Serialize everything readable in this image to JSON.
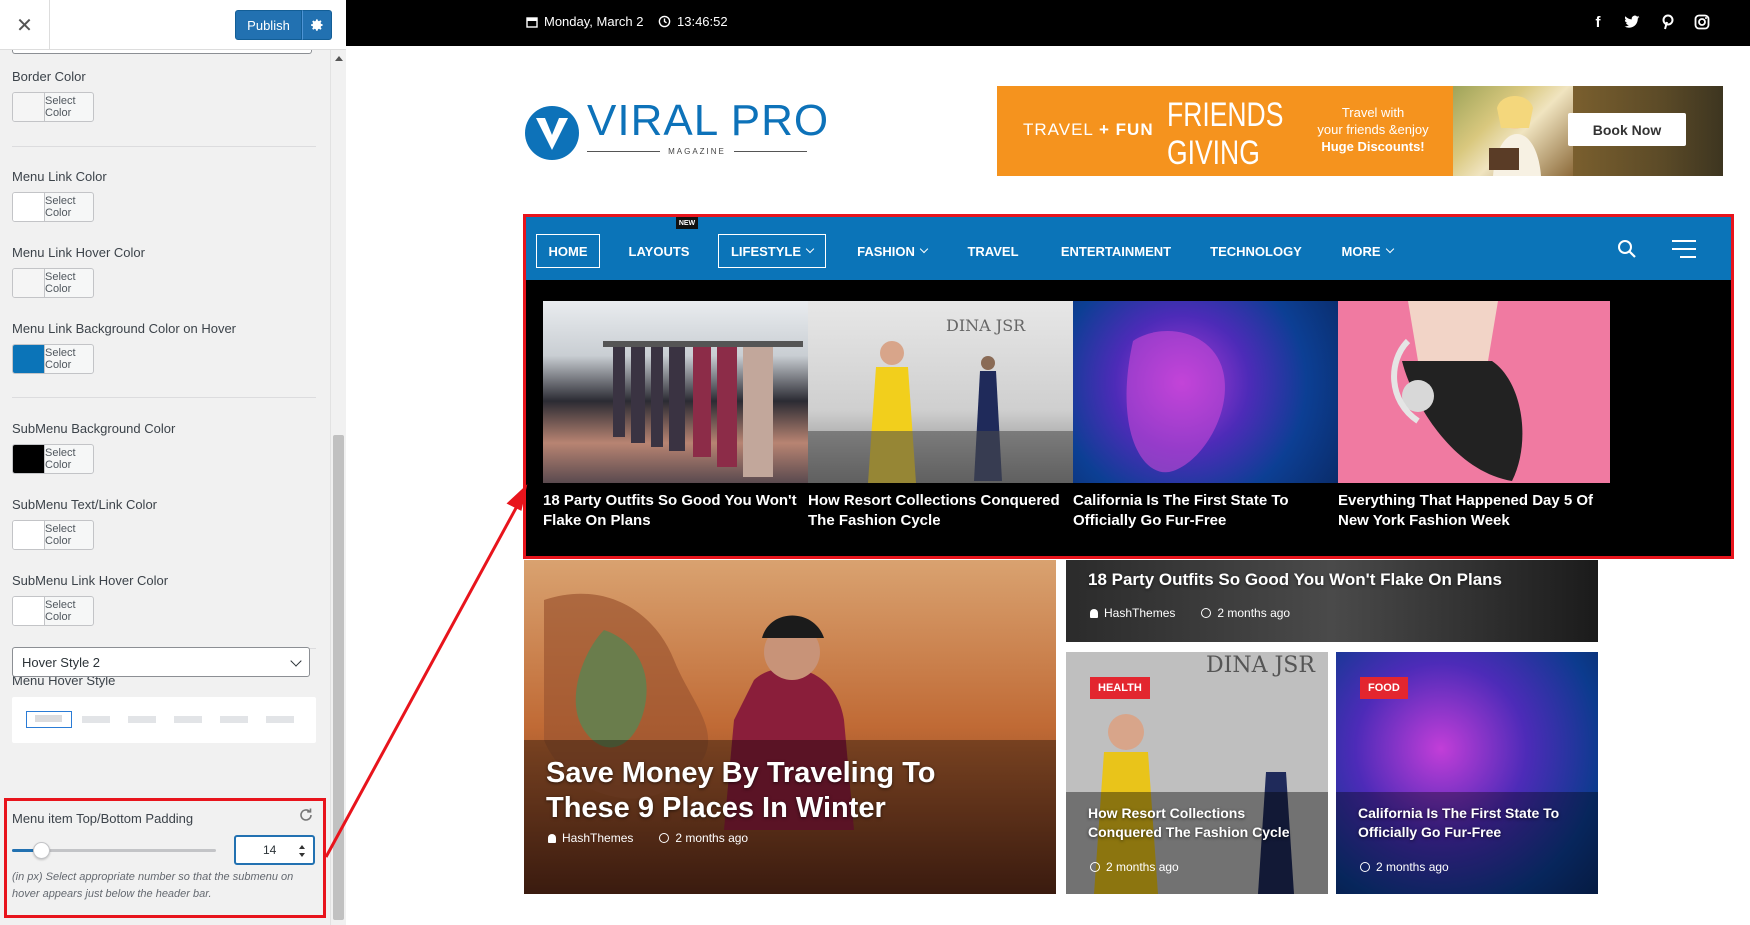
{
  "customizer": {
    "close_symbol": "✕",
    "publish_label": "Publish",
    "controls": {
      "border_color": {
        "label": "Border Color",
        "swatch": "#f5f5f5",
        "button": "Select Color"
      },
      "menu_link_color": {
        "label": "Menu Link Color",
        "swatch": "#ffffff",
        "button": "Select Color"
      },
      "menu_link_hover_color": {
        "label": "Menu Link Hover Color",
        "swatch": "#f5f5f5",
        "button": "Select Color"
      },
      "menu_link_bg_hover": {
        "label": "Menu Link Background Color on Hover",
        "swatch": "#0b74b8",
        "button": "Select Color"
      },
      "submenu_bg_color": {
        "label": "SubMenu Background Color",
        "swatch": "#000000",
        "button": "Select Color"
      },
      "submenu_text_color": {
        "label": "SubMenu Text/Link Color",
        "swatch": "#ffffff",
        "button": "Select Color"
      },
      "submenu_link_hover": {
        "label": "SubMenu Link Hover Color",
        "swatch": "#ffffff",
        "button": "Select Color"
      }
    },
    "menu_hover_style": {
      "label": "Menu Hover Style",
      "selected": "Hover Style 2"
    },
    "padding": {
      "label": "Menu item Top/Bottom Padding",
      "value": "14",
      "slider_fraction": 0.14,
      "help": "(in px) Select appropriate number so that the submenu on hover appears just below the header bar."
    },
    "accent_color": "#2271b1",
    "highlight_color": "#e8141c"
  },
  "site": {
    "topbar": {
      "date": "Monday, March 2",
      "time": "13:46:52"
    },
    "social_icons": [
      "facebook-icon",
      "twitter-icon",
      "pinterest-icon",
      "instagram-icon"
    ],
    "logo": {
      "word": "VIRAL PRO",
      "sub": "MAGAZINE"
    },
    "ad": {
      "travel": "TRAVEL",
      "plus": "+",
      "fun": "FUN",
      "friends": "FRIENDS",
      "giving": "GIVING",
      "line1": "Travel with",
      "line2": "your friends &enjoy",
      "line3": "Huge Discounts!",
      "cta": "Book Now"
    },
    "nav": {
      "items": [
        {
          "label": "HOME",
          "boxed": true
        },
        {
          "label": "LAYOUTS",
          "badge": "NEW"
        },
        {
          "label": "LIFESTYLE",
          "boxed": true,
          "dropdown": true
        },
        {
          "label": "FASHION",
          "dropdown": true
        },
        {
          "label": "TRAVEL"
        },
        {
          "label": "ENTERTAINMENT"
        },
        {
          "label": "TECHNOLOGY"
        },
        {
          "label": "MORE",
          "dropdown": true
        }
      ],
      "bar_color": "#0b74b8"
    },
    "mega_menu": [
      {
        "title": "18 Party Outfits So Good You Won't Flake On Plans"
      },
      {
        "title": "How Resort Collections Conquered The Fashion Cycle"
      },
      {
        "title": "California Is The First State To Officially Go Fur-Free"
      },
      {
        "title": "Everything That Happened Day 5 Of New York Fashion Week"
      }
    ],
    "featured": {
      "main": {
        "title": "Save Money By Traveling To These 9 Places In Winter",
        "author": "HashThemes",
        "time": "2 months ago"
      },
      "top_right": {
        "title": "18 Party Outfits So Good You Won't Flake On Plans",
        "author": "HashThemes",
        "time": "2 months ago"
      },
      "bottom_left": {
        "category": "HEALTH",
        "title": "How Resort Collections Conquered The Fashion Cycle",
        "time": "2 months ago"
      },
      "bottom_right": {
        "category": "FOOD",
        "title": "California Is The First State To Officially Go Fur-Free",
        "time": "2 months ago"
      }
    }
  }
}
